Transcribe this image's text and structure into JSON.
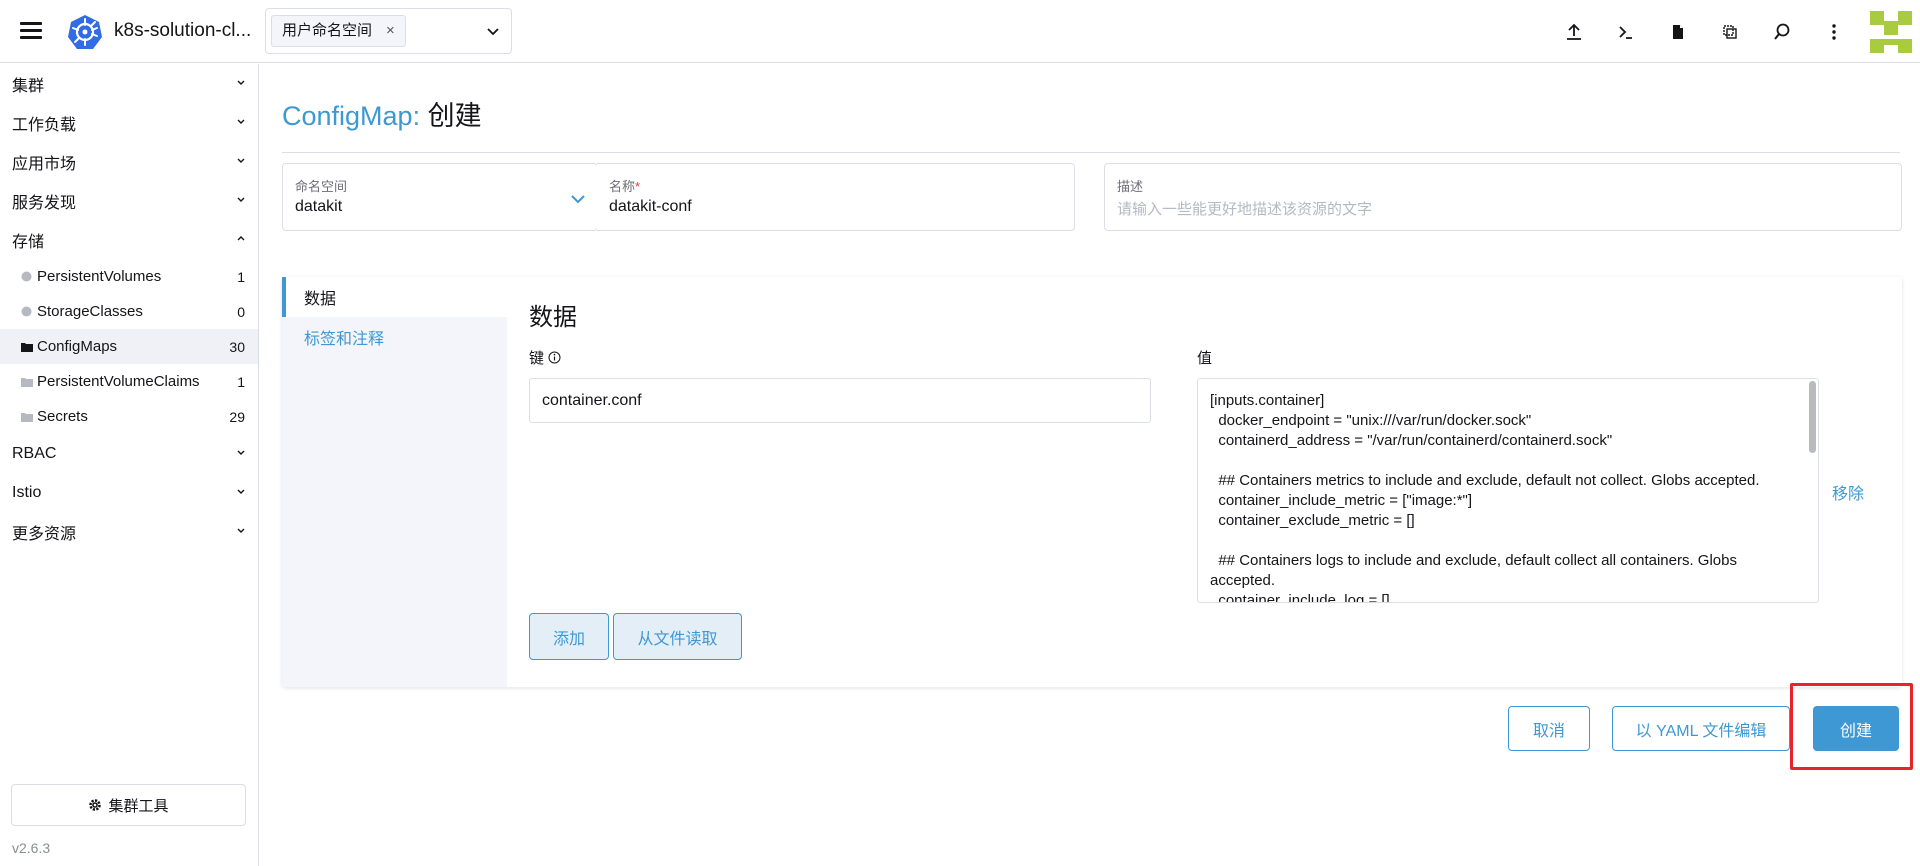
{
  "header": {
    "cluster_name": "k8s-solution-cl...",
    "namespace_chip": "用户命名空间",
    "namespace_chip_close": "×",
    "icons": [
      "upload-icon",
      "terminal-icon",
      "file-icon",
      "copy-icon",
      "search-icon",
      "more-vertical-icon"
    ]
  },
  "sidebar": {
    "groups_top": [
      {
        "label": "集群"
      },
      {
        "label": "工作负载"
      },
      {
        "label": "应用市场"
      },
      {
        "label": "服务发现"
      },
      {
        "label": "存储"
      }
    ],
    "storage_items": [
      {
        "label": "PersistentVolumes",
        "count": "1"
      },
      {
        "label": "StorageClasses",
        "count": "0"
      },
      {
        "label": "ConfigMaps",
        "count": "30"
      },
      {
        "label": "PersistentVolumeClaims",
        "count": "1"
      },
      {
        "label": "Secrets",
        "count": "29"
      }
    ],
    "groups_bottom": [
      {
        "label": "RBAC"
      },
      {
        "label": "Istio"
      },
      {
        "label": "更多资源"
      }
    ],
    "tools_label": "集群工具",
    "version": "v2.6.3"
  },
  "main": {
    "title_resource": "ConfigMap:",
    "title_action": "创建",
    "namespace_field": {
      "label": "命名空间",
      "value": "datakit"
    },
    "name_field": {
      "label": "名称",
      "required": "*",
      "value": "datakit-conf"
    },
    "description_field": {
      "label": "描述",
      "placeholder": "请输入一些能更好地描述该资源的文字"
    },
    "tabs": [
      {
        "label": "数据"
      },
      {
        "label": "标签和注释"
      }
    ],
    "section_title": "数据",
    "key_label": "键",
    "value_label": "值",
    "key_value": "container.conf",
    "value_text": "[inputs.container]\n  docker_endpoint = \"unix:///var/run/docker.sock\"\n  containerd_address = \"/var/run/containerd/containerd.sock\"\n\n  ## Containers metrics to include and exclude, default not collect. Globs accepted.\n  container_include_metric = [\"image:*\"]\n  container_exclude_metric = []\n\n  ## Containers logs to include and exclude, default collect all containers. Globs accepted.\n  container_include_log = []",
    "remove_label": "移除",
    "add_label": "添加",
    "read_file_label": "从文件读取"
  },
  "footer": {
    "cancel_label": "取消",
    "yaml_label": "以 YAML 文件编辑",
    "create_label": "创建"
  },
  "colors": {
    "accent": "#3d98d3",
    "highlight": "#e8232a"
  }
}
